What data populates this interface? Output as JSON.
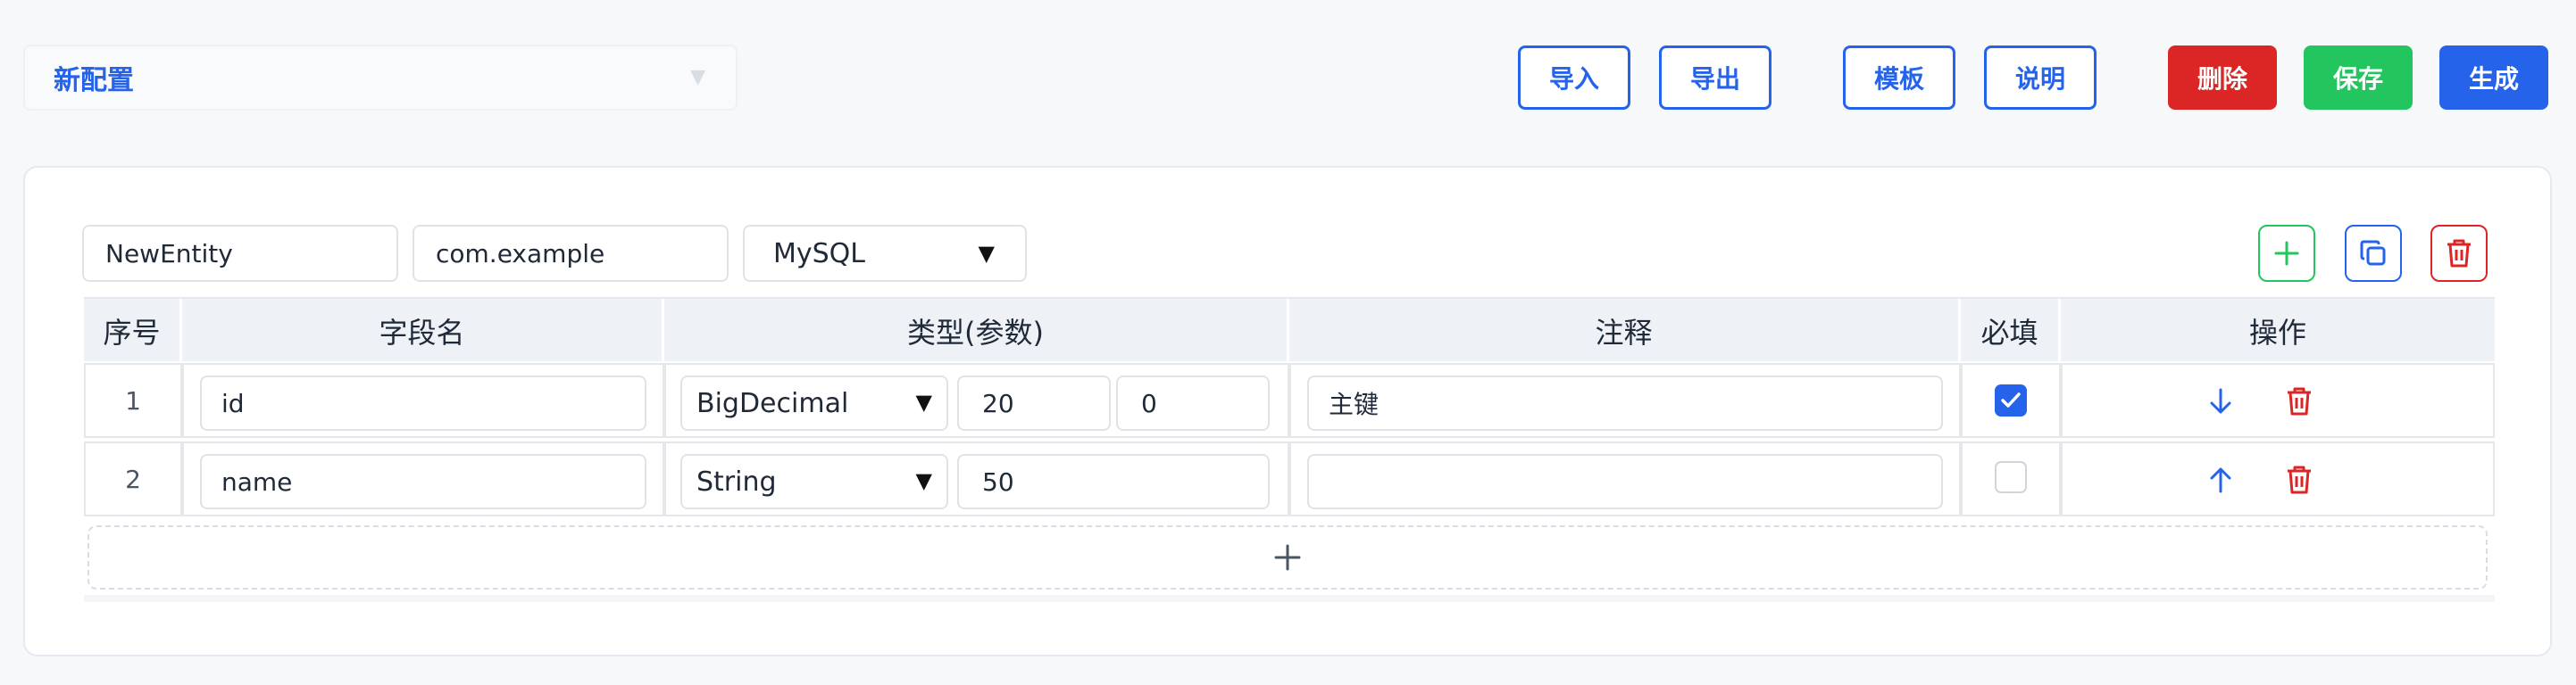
{
  "config": {
    "name": "新配置"
  },
  "toolbar": {
    "import_label": "导入",
    "export_label": "导出",
    "template_label": "模板",
    "help_label": "说明",
    "delete_label": "删除",
    "save_label": "保存",
    "generate_label": "生成"
  },
  "entity": {
    "name": "NewEntity",
    "package": "com.example",
    "database": "MySQL"
  },
  "table": {
    "headers": [
      "序号",
      "字段名",
      "类型(参数)",
      "注释",
      "必填",
      "操作"
    ],
    "rows": [
      {
        "index": "1",
        "field": "id",
        "type": "BigDecimal",
        "param1": "20",
        "param2": "0",
        "comment": "主键",
        "required": true
      },
      {
        "index": "2",
        "field": "name",
        "type": "String",
        "param1": "50",
        "param2": "",
        "comment": "",
        "required": false
      }
    ]
  },
  "colors": {
    "primary": "#2563eb",
    "danger": "#dc2626",
    "success": "#22c55e"
  },
  "icons": {
    "select_caret": "▼",
    "add_row": "+"
  }
}
